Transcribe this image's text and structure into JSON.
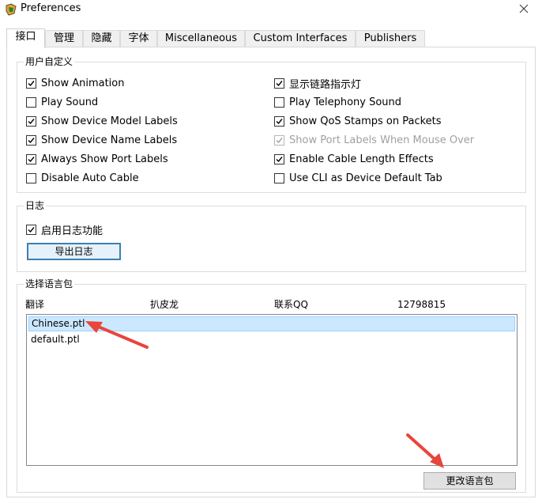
{
  "window": {
    "title": "Preferences"
  },
  "tabs": [
    {
      "label": "接口",
      "active": true
    },
    {
      "label": "管理",
      "active": false
    },
    {
      "label": "隐藏",
      "active": false
    },
    {
      "label": "字体",
      "active": false
    },
    {
      "label": "Miscellaneous",
      "active": false
    },
    {
      "label": "Custom Interfaces",
      "active": false
    },
    {
      "label": "Publishers",
      "active": false
    }
  ],
  "customize": {
    "title": "用户自定义",
    "left": [
      {
        "label": "Show Animation",
        "checked": true
      },
      {
        "label": "Play Sound",
        "checked": false
      },
      {
        "label": "Show Device Model Labels",
        "checked": true
      },
      {
        "label": "Show Device Name Labels",
        "checked": true
      },
      {
        "label": "Always Show Port Labels",
        "checked": true
      },
      {
        "label": "Disable Auto Cable",
        "checked": false
      }
    ],
    "right": [
      {
        "label": "显示链路指示灯",
        "checked": true
      },
      {
        "label": "Play Telephony Sound",
        "checked": false
      },
      {
        "label": "Show QoS Stamps on Packets",
        "checked": true
      },
      {
        "label": "Show Port Labels When Mouse Over",
        "checked": true,
        "disabled": true
      },
      {
        "label": "Enable Cable Length Effects",
        "checked": true
      },
      {
        "label": "Use CLI as Device Default Tab",
        "checked": false
      }
    ]
  },
  "log": {
    "title": "日志",
    "enable_label": "启用日志功能",
    "enable_checked": true,
    "export_label": "导出日志"
  },
  "language": {
    "title": "选择语言包",
    "header": [
      "翻译",
      "扒皮龙",
      "联系QQ",
      "12798815"
    ],
    "items": [
      "Chinese.ptl",
      "default.ptl"
    ],
    "selected_index": 0,
    "change_label": "更改语言包"
  },
  "colors": {
    "annotation_arrow": "#e8453c",
    "selection": "#cce8ff",
    "focus_border": "#3c7fb1"
  }
}
